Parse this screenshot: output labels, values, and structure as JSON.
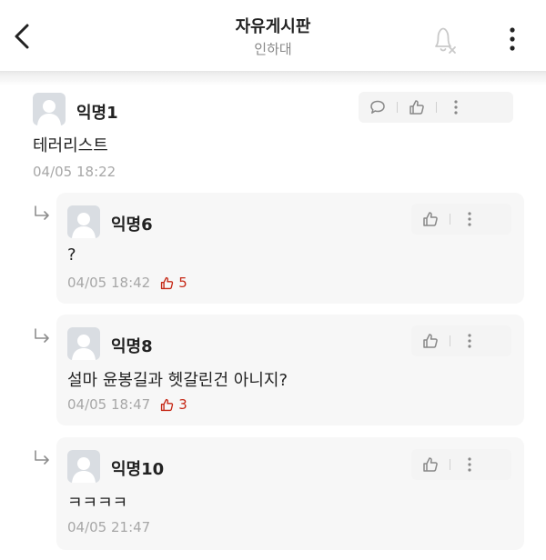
{
  "header": {
    "title": "자유게시판",
    "subtitle": "인하대"
  },
  "icons": {
    "back": "chevron-left-icon",
    "bell": "bell-off-icon",
    "more": "more-vertical-icon",
    "comment": "comment-icon",
    "like": "thumbs-up-icon",
    "reply": "reply-arrow-icon"
  },
  "colors": {
    "like_count": "#c62917",
    "timestamp": "#a7a7a7",
    "reply_background": "#f7f7f7",
    "action_background": "#f4f4f4"
  },
  "comment": {
    "author": "익명1",
    "text": "테러리스트",
    "time": "04/05 18:22"
  },
  "replies": [
    {
      "author": "익명6",
      "text": "?",
      "time": "04/05 18:42",
      "likes": "5"
    },
    {
      "author": "익명8",
      "text": "설마 윤봉길과 헷갈린건 아니지?",
      "time": "04/05 18:47",
      "likes": "3"
    },
    {
      "author": "익명10",
      "text": "ㅋㅋㅋㅋ",
      "time": "04/05 21:47"
    }
  ]
}
